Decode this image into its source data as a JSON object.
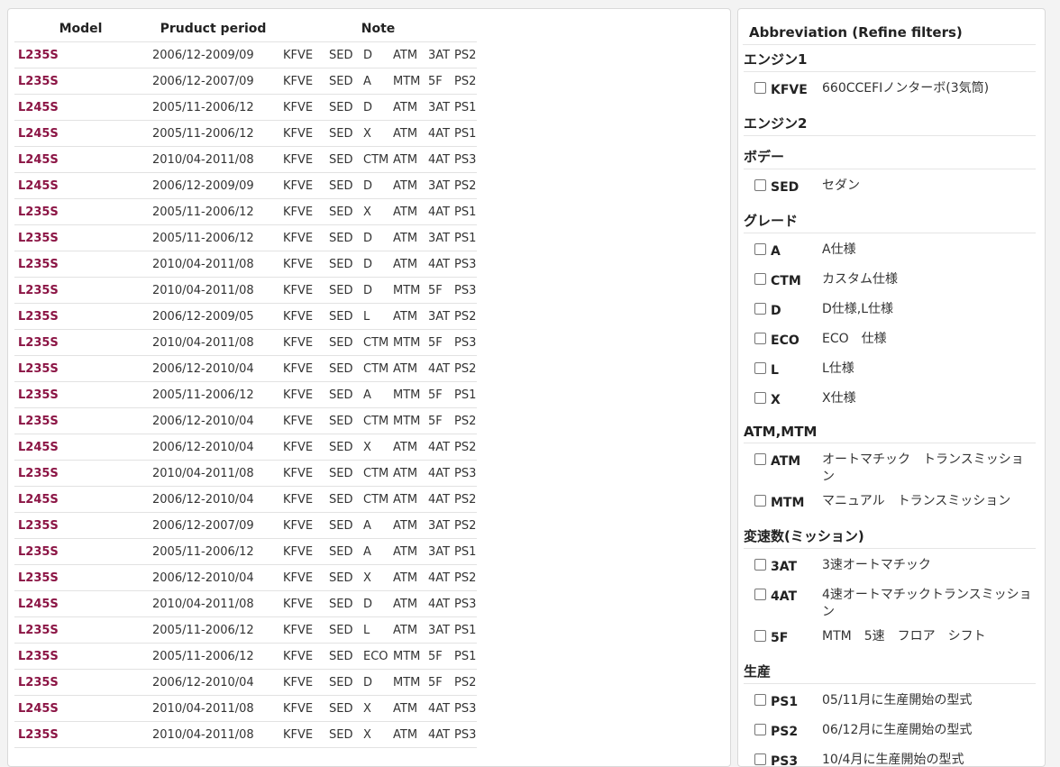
{
  "table": {
    "headers": {
      "model": "Model",
      "period": "Pruduct period",
      "note": "Note"
    },
    "rows": [
      [
        "L235S",
        "2006/12-2009/09",
        "KFVE",
        "SED",
        "D",
        "ATM",
        "3AT",
        "PS2"
      ],
      [
        "L235S",
        "2006/12-2007/09",
        "KFVE",
        "SED",
        "A",
        "MTM",
        "5F",
        "PS2"
      ],
      [
        "L245S",
        "2005/11-2006/12",
        "KFVE",
        "SED",
        "D",
        "ATM",
        "3AT",
        "PS1"
      ],
      [
        "L245S",
        "2005/11-2006/12",
        "KFVE",
        "SED",
        "X",
        "ATM",
        "4AT",
        "PS1"
      ],
      [
        "L245S",
        "2010/04-2011/08",
        "KFVE",
        "SED",
        "CTM",
        "ATM",
        "4AT",
        "PS3"
      ],
      [
        "L245S",
        "2006/12-2009/09",
        "KFVE",
        "SED",
        "D",
        "ATM",
        "3AT",
        "PS2"
      ],
      [
        "L235S",
        "2005/11-2006/12",
        "KFVE",
        "SED",
        "X",
        "ATM",
        "4AT",
        "PS1"
      ],
      [
        "L235S",
        "2005/11-2006/12",
        "KFVE",
        "SED",
        "D",
        "ATM",
        "3AT",
        "PS1"
      ],
      [
        "L235S",
        "2010/04-2011/08",
        "KFVE",
        "SED",
        "D",
        "ATM",
        "4AT",
        "PS3"
      ],
      [
        "L235S",
        "2010/04-2011/08",
        "KFVE",
        "SED",
        "D",
        "MTM",
        "5F",
        "PS3"
      ],
      [
        "L235S",
        "2006/12-2009/05",
        "KFVE",
        "SED",
        "L",
        "ATM",
        "3AT",
        "PS2"
      ],
      [
        "L235S",
        "2010/04-2011/08",
        "KFVE",
        "SED",
        "CTM",
        "MTM",
        "5F",
        "PS3"
      ],
      [
        "L235S",
        "2006/12-2010/04",
        "KFVE",
        "SED",
        "CTM",
        "ATM",
        "4AT",
        "PS2"
      ],
      [
        "L235S",
        "2005/11-2006/12",
        "KFVE",
        "SED",
        "A",
        "MTM",
        "5F",
        "PS1"
      ],
      [
        "L235S",
        "2006/12-2010/04",
        "KFVE",
        "SED",
        "CTM",
        "MTM",
        "5F",
        "PS2"
      ],
      [
        "L245S",
        "2006/12-2010/04",
        "KFVE",
        "SED",
        "X",
        "ATM",
        "4AT",
        "PS2"
      ],
      [
        "L235S",
        "2010/04-2011/08",
        "KFVE",
        "SED",
        "CTM",
        "ATM",
        "4AT",
        "PS3"
      ],
      [
        "L245S",
        "2006/12-2010/04",
        "KFVE",
        "SED",
        "CTM",
        "ATM",
        "4AT",
        "PS2"
      ],
      [
        "L235S",
        "2006/12-2007/09",
        "KFVE",
        "SED",
        "A",
        "ATM",
        "3AT",
        "PS2"
      ],
      [
        "L235S",
        "2005/11-2006/12",
        "KFVE",
        "SED",
        "A",
        "ATM",
        "3AT",
        "PS1"
      ],
      [
        "L235S",
        "2006/12-2010/04",
        "KFVE",
        "SED",
        "X",
        "ATM",
        "4AT",
        "PS2"
      ],
      [
        "L245S",
        "2010/04-2011/08",
        "KFVE",
        "SED",
        "D",
        "ATM",
        "4AT",
        "PS3"
      ],
      [
        "L235S",
        "2005/11-2006/12",
        "KFVE",
        "SED",
        "L",
        "ATM",
        "3AT",
        "PS1"
      ],
      [
        "L235S",
        "2005/11-2006/12",
        "KFVE",
        "SED",
        "ECO",
        "MTM",
        "5F",
        "PS1"
      ],
      [
        "L235S",
        "2006/12-2010/04",
        "KFVE",
        "SED",
        "D",
        "MTM",
        "5F",
        "PS2"
      ],
      [
        "L245S",
        "2010/04-2011/08",
        "KFVE",
        "SED",
        "X",
        "ATM",
        "4AT",
        "PS3"
      ],
      [
        "L235S",
        "2010/04-2011/08",
        "KFVE",
        "SED",
        "X",
        "ATM",
        "4AT",
        "PS3"
      ]
    ]
  },
  "abbreviation": {
    "title": "Abbreviation (Refine filters)",
    "sections": [
      {
        "heading": "エンジン1",
        "options": [
          {
            "code": "KFVE",
            "desc": "660CCEFIノンターボ(3気筒)"
          }
        ]
      },
      {
        "heading": "エンジン2",
        "options": []
      },
      {
        "heading": "ボデー",
        "options": [
          {
            "code": "SED",
            "desc": "セダン"
          }
        ]
      },
      {
        "heading": "グレード",
        "options": [
          {
            "code": "A",
            "desc": "A仕様"
          },
          {
            "code": "CTM",
            "desc": "カスタム仕様"
          },
          {
            "code": "D",
            "desc": "D仕様,L仕様"
          },
          {
            "code": "ECO",
            "desc": "ECO　仕様"
          },
          {
            "code": "L",
            "desc": "L仕様"
          },
          {
            "code": "X",
            "desc": "X仕様"
          }
        ]
      },
      {
        "heading": "ATM,MTM",
        "options": [
          {
            "code": "ATM",
            "desc": "オートマチック　トランスミッション"
          },
          {
            "code": "MTM",
            "desc": "マニュアル　トランスミッション"
          }
        ]
      },
      {
        "heading": "変速数(ミッション)",
        "options": [
          {
            "code": "3AT",
            "desc": "3速オートマチック"
          },
          {
            "code": "4AT",
            "desc": "4速オートマチックトランスミッション"
          },
          {
            "code": "5F",
            "desc": "MTM　5速　フロア　シフト"
          }
        ]
      },
      {
        "heading": "生産",
        "options": [
          {
            "code": "PS1",
            "desc": "05/11月に生産開始の型式"
          },
          {
            "code": "PS2",
            "desc": "06/12月に生産開始の型式"
          },
          {
            "code": "PS3",
            "desc": "10/4月に生産開始の型式"
          }
        ]
      }
    ]
  }
}
